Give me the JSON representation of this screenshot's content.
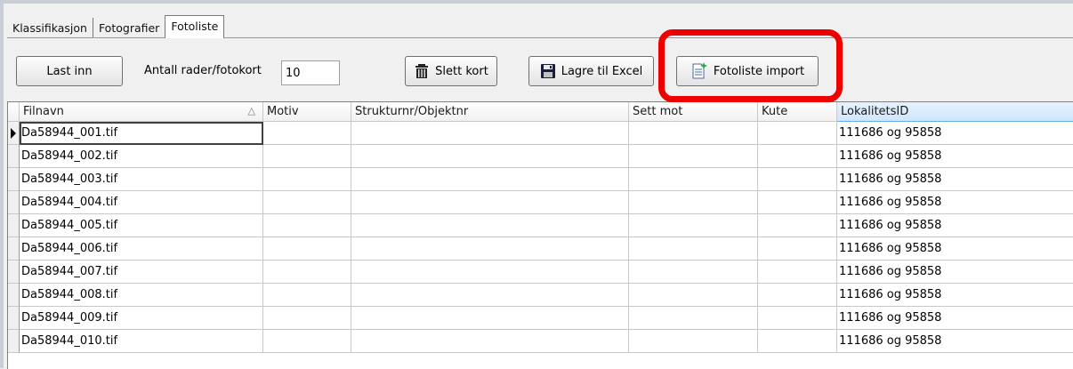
{
  "tabs": [
    {
      "label": "Klassifikasjon",
      "active": false
    },
    {
      "label": "Fotografier",
      "active": false
    },
    {
      "label": "Fotoliste",
      "active": true
    }
  ],
  "toolbar": {
    "load_label": "Last inn",
    "rows_label": "Antall rader/fotokort",
    "rows_value": "10",
    "delete_label": "Slett kort",
    "delete_icon": "trash-icon",
    "excel_label": "Lagre til Excel",
    "excel_icon": "floppy-disk-icon",
    "import_label": "Fotoliste import",
    "import_icon": "new-document-icon"
  },
  "highlight_color": "#ee0000",
  "grid": {
    "columns": [
      "Filnavn",
      "Motiv",
      "Strukturnr/Objektnr",
      "Sett mot",
      "Kute",
      "LokalitetsID"
    ],
    "sort_indicator": "△",
    "sorted_column": "Filnavn",
    "selected_column": "LokalitetsID",
    "rows": [
      {
        "filnavn": "Da58944_001.tif",
        "motiv": "",
        "strukturnr": "",
        "sett_mot": "",
        "kute": "",
        "lokalitetsid": "111686 og 95858"
      },
      {
        "filnavn": "Da58944_002.tif",
        "motiv": "",
        "strukturnr": "",
        "sett_mot": "",
        "kute": "",
        "lokalitetsid": "111686 og 95858"
      },
      {
        "filnavn": "Da58944_003.tif",
        "motiv": "",
        "strukturnr": "",
        "sett_mot": "",
        "kute": "",
        "lokalitetsid": "111686 og 95858"
      },
      {
        "filnavn": "Da58944_004.tif",
        "motiv": "",
        "strukturnr": "",
        "sett_mot": "",
        "kute": "",
        "lokalitetsid": "111686 og 95858"
      },
      {
        "filnavn": "Da58944_005.tif",
        "motiv": "",
        "strukturnr": "",
        "sett_mot": "",
        "kute": "",
        "lokalitetsid": "111686 og 95858"
      },
      {
        "filnavn": "Da58944_006.tif",
        "motiv": "",
        "strukturnr": "",
        "sett_mot": "",
        "kute": "",
        "lokalitetsid": "111686 og 95858"
      },
      {
        "filnavn": "Da58944_007.tif",
        "motiv": "",
        "strukturnr": "",
        "sett_mot": "",
        "kute": "",
        "lokalitetsid": "111686 og 95858"
      },
      {
        "filnavn": "Da58944_008.tif",
        "motiv": "",
        "strukturnr": "",
        "sett_mot": "",
        "kute": "",
        "lokalitetsid": "111686 og 95858"
      },
      {
        "filnavn": "Da58944_009.tif",
        "motiv": "",
        "strukturnr": "",
        "sett_mot": "",
        "kute": "",
        "lokalitetsid": "111686 og 95858"
      },
      {
        "filnavn": "Da58944_010.tif",
        "motiv": "",
        "strukturnr": "",
        "sett_mot": "",
        "kute": "",
        "lokalitetsid": "111686 og 95858"
      }
    ]
  }
}
